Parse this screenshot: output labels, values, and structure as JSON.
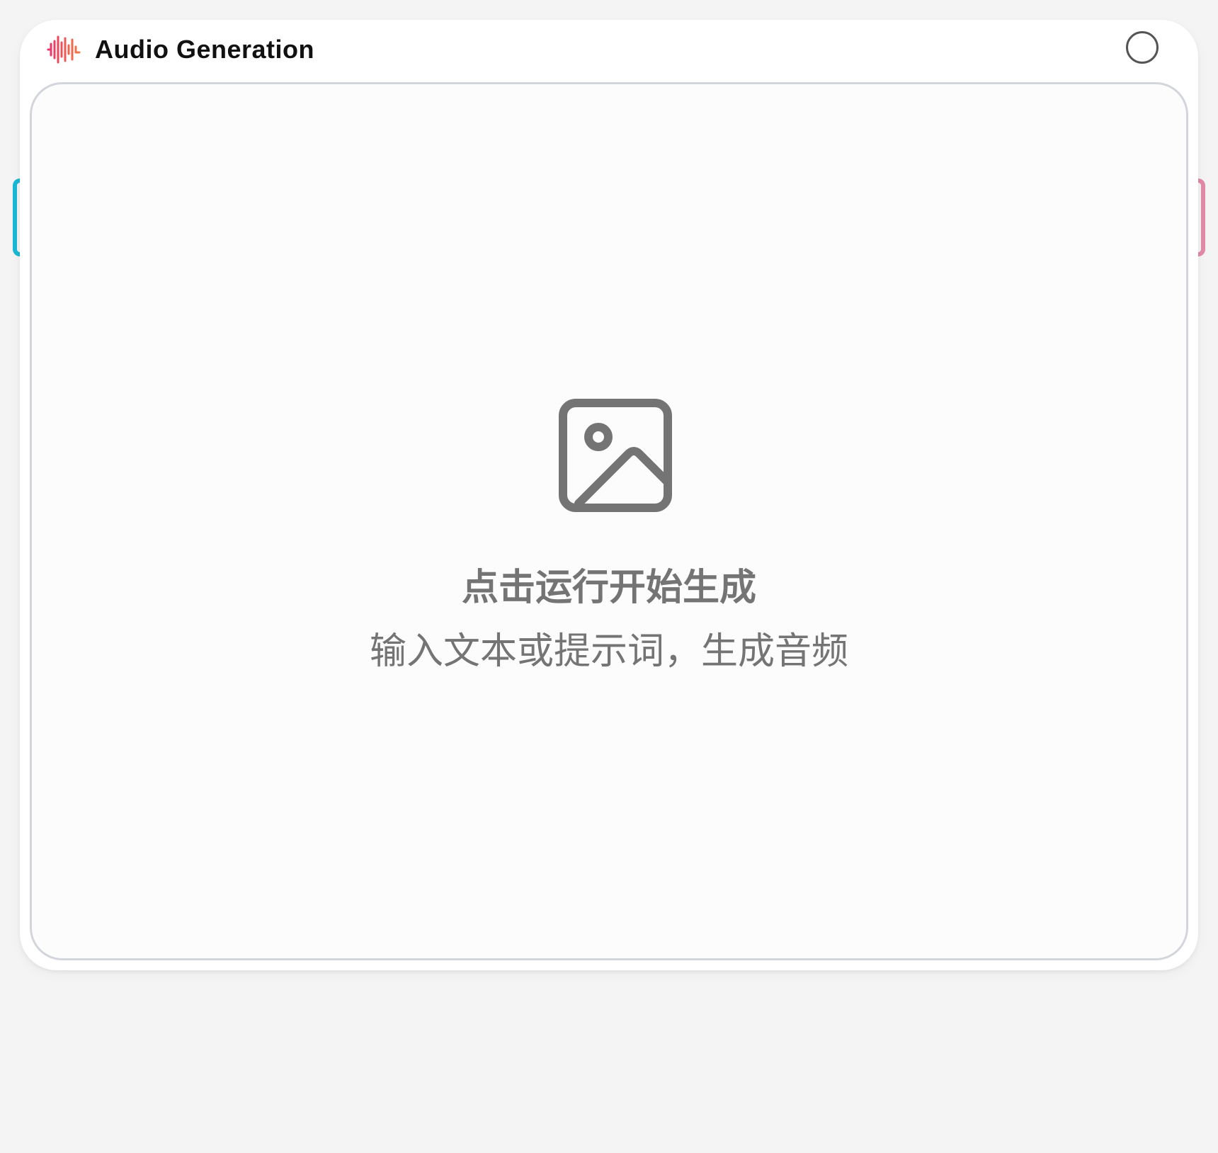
{
  "node": {
    "title": "Audio Generation",
    "icon": "waveform-icon",
    "status_icon": "status-circle-icon"
  },
  "preview": {
    "icon": "image-placeholder-icon",
    "title": "点击运行开始生成",
    "subtitle": "输入文本或提示词，生成音频"
  },
  "handles": {
    "input_color": "#1ab8d6",
    "output_color": "#e28aa8"
  },
  "colors": {
    "accent_gradient_start": "#e8336b",
    "accent_gradient_end": "#f47a45",
    "placeholder_text": "#747474",
    "panel_border": "#d2d5db"
  }
}
